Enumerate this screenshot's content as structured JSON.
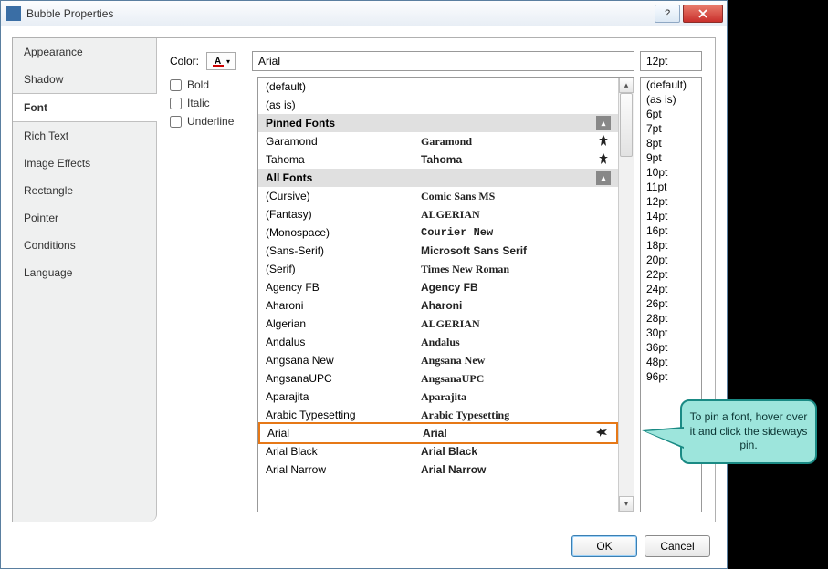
{
  "window": {
    "title": "Bubble Properties"
  },
  "sidebar": {
    "items": [
      {
        "label": "Appearance"
      },
      {
        "label": "Shadow"
      },
      {
        "label": "Font",
        "active": true
      },
      {
        "label": "Rich Text"
      },
      {
        "label": "Image Effects"
      },
      {
        "label": "Rectangle"
      },
      {
        "label": "Pointer"
      },
      {
        "label": "Conditions"
      },
      {
        "label": "Language"
      }
    ]
  },
  "font_panel": {
    "color_label": "Color:",
    "styles": {
      "bold": "Bold",
      "italic": "Italic",
      "underline": "Underline"
    },
    "font_value": "Arial",
    "size_value": "12pt",
    "headers": {
      "pinned": "Pinned Fonts",
      "all": "All Fonts"
    },
    "top_items": [
      {
        "name": "(default)"
      },
      {
        "name": "(as is)"
      }
    ],
    "pinned": [
      {
        "name": "Garamond",
        "preview": "Garamond",
        "preview_family": "Garamond, serif",
        "pinned": true
      },
      {
        "name": "Tahoma",
        "preview": "Tahoma",
        "preview_family": "Tahoma, sans-serif",
        "pinned": true
      }
    ],
    "all": [
      {
        "name": "(Cursive)",
        "preview": "Comic Sans MS",
        "preview_family": "'Comic Sans MS', cursive"
      },
      {
        "name": "(Fantasy)",
        "preview": "ALGERIAN",
        "preview_family": "fantasy"
      },
      {
        "name": "(Monospace)",
        "preview": "Courier New",
        "preview_family": "'Courier New', monospace"
      },
      {
        "name": "(Sans-Serif)",
        "preview": "Microsoft Sans Serif",
        "preview_family": "'Microsoft Sans Serif', sans-serif"
      },
      {
        "name": "(Serif)",
        "preview": "Times New Roman",
        "preview_family": "'Times New Roman', serif"
      },
      {
        "name": "Agency FB",
        "preview": "Agency FB",
        "preview_family": "sans-serif"
      },
      {
        "name": "Aharoni",
        "preview": "Aharoni",
        "preview_family": "sans-serif"
      },
      {
        "name": "Algerian",
        "preview": "ALGERIAN",
        "preview_family": "fantasy"
      },
      {
        "name": "Andalus",
        "preview": "Andalus",
        "preview_family": "serif"
      },
      {
        "name": "Angsana New",
        "preview": "Angsana New",
        "preview_family": "serif"
      },
      {
        "name": "AngsanaUPC",
        "preview": "AngsanaUPC",
        "preview_family": "serif"
      },
      {
        "name": "Aparajita",
        "preview": "Aparajita",
        "preview_family": "serif"
      },
      {
        "name": "Arabic Typesetting",
        "preview": "Arabic Typesetting",
        "preview_family": "serif"
      },
      {
        "name": "Arial",
        "preview": "Arial",
        "preview_family": "Arial, sans-serif",
        "selected": true,
        "hover_pin": true
      },
      {
        "name": "Arial Black",
        "preview": "Arial Black",
        "preview_family": "'Arial Black', sans-serif"
      },
      {
        "name": "Arial Narrow",
        "preview": "Arial Narrow",
        "preview_family": "Arial, sans-serif"
      }
    ],
    "sizes": [
      "(default)",
      "(as is)",
      "6pt",
      "7pt",
      "8pt",
      "9pt",
      "10pt",
      "11pt",
      "12pt",
      "14pt",
      "16pt",
      "18pt",
      "20pt",
      "22pt",
      "24pt",
      "26pt",
      "28pt",
      "30pt",
      "36pt",
      "48pt",
      "96pt"
    ]
  },
  "buttons": {
    "ok": "OK",
    "cancel": "Cancel"
  },
  "callout": {
    "text": "To pin a font, hover over it and click the sideways pin."
  }
}
